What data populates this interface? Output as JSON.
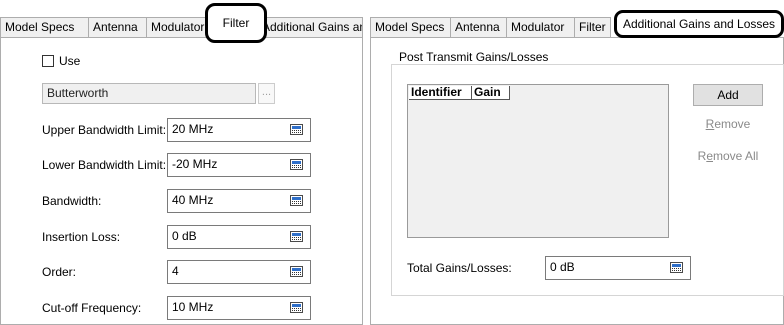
{
  "left_panel": {
    "tabs": [
      "Model Specs",
      "Antenna",
      "Modulator",
      "Filter",
      "Additional Gains and Losses"
    ],
    "active_tab": "Filter",
    "use_checkbox": {
      "label": "Use",
      "checked": false
    },
    "filter_type": "Butterworth",
    "ellipsis_label": "...",
    "fields": [
      {
        "label": "Upper Bandwidth Limit:",
        "value": "20 MHz"
      },
      {
        "label": "Lower Bandwidth Limit:",
        "value": "-20 MHz"
      },
      {
        "label": "Bandwidth:",
        "value": "40 MHz"
      },
      {
        "label": "Insertion Loss:",
        "value": "0 dB"
      },
      {
        "label": "Order:",
        "value": "4"
      },
      {
        "label": "Cut-off Frequency:",
        "value": "10 MHz"
      }
    ]
  },
  "right_panel": {
    "tabs": [
      "Model Specs",
      "Antenna",
      "Modulator",
      "Filter",
      "Additional Gains and Losses"
    ],
    "active_tab": "Additional Gains and Losses",
    "group_title": "Post Transmit Gains/Losses",
    "columns": [
      "Identifier",
      "Gain"
    ],
    "rows": [],
    "buttons": {
      "add": "Add",
      "remove": "Remove",
      "remove_all": "Remove All"
    },
    "total_label": "Total Gains/Losses:",
    "total_value": "0 dB"
  },
  "icons": {
    "field_button": "calculator-icon"
  },
  "colors": {
    "tab_background": "#f0f0f0",
    "page_background": "#ffffff",
    "highlight_outline": "#000000",
    "field_icon_accent": "#2f6fc9"
  }
}
